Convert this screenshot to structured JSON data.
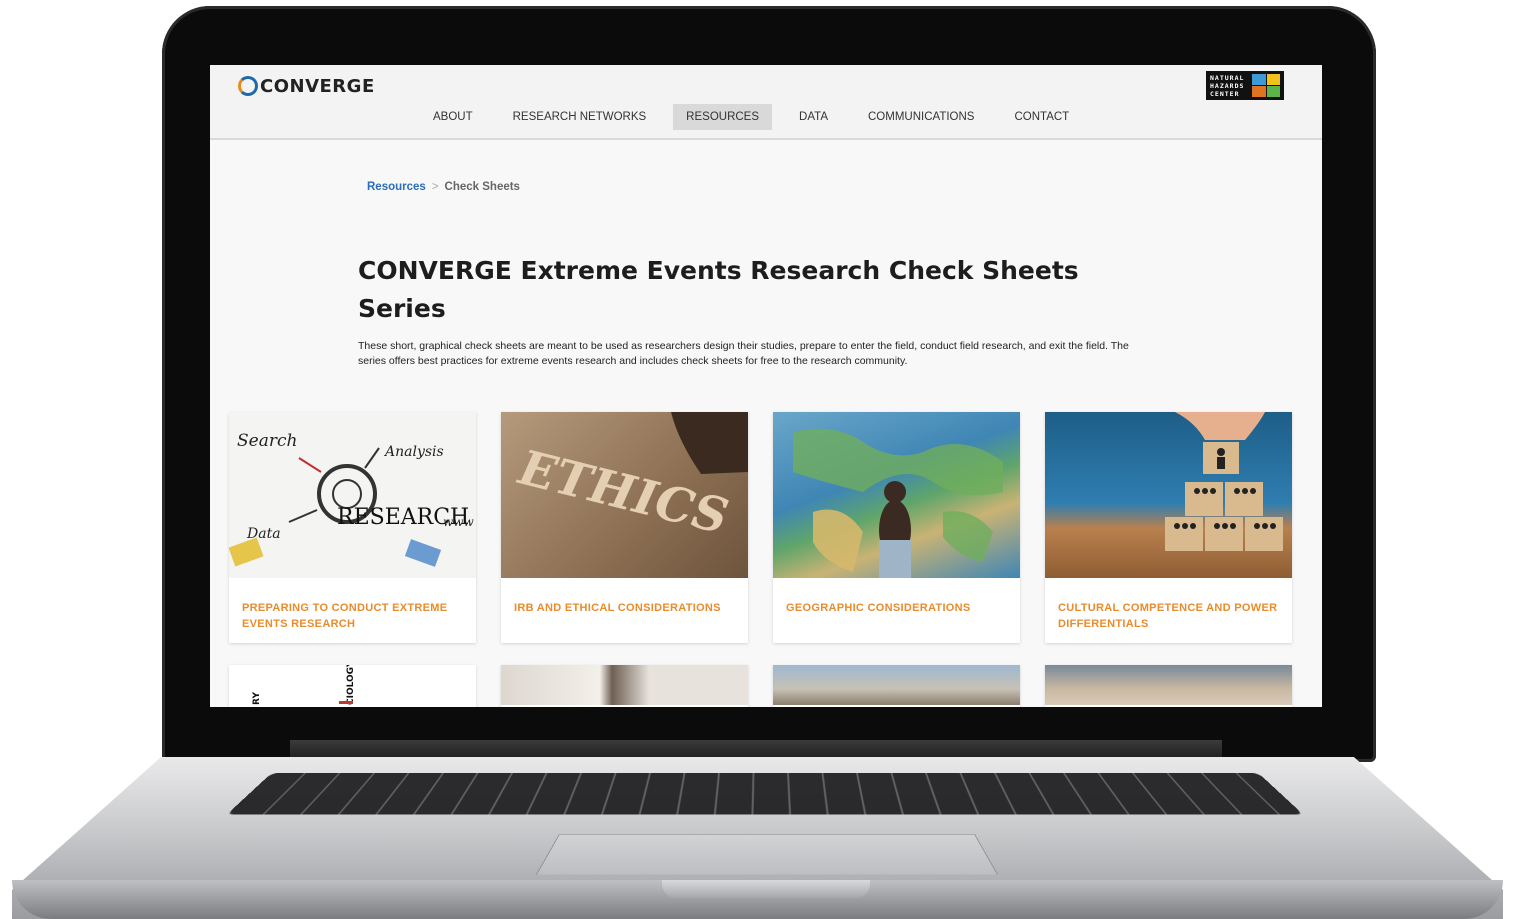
{
  "site": {
    "logo_text": "CONVERGE",
    "partner_logo_text": "NATURAL\nHAZARDS\nCENTER"
  },
  "nav": {
    "items": [
      "ABOUT",
      "RESEARCH NETWORKS",
      "RESOURCES",
      "DATA",
      "COMMUNICATIONS",
      "CONTACT"
    ],
    "active": "RESOURCES"
  },
  "breadcrumb": {
    "parent": "Resources",
    "separator": ">",
    "current": "Check Sheets"
  },
  "page": {
    "title": "CONVERGE Extreme Events Research Check Sheets Series",
    "description": "These short, graphical check sheets are meant to be used as researchers design their studies, prepare to enter the field, conduct field research, and exit the field. The series offers best practices for extreme events research and includes check sheets for free to the research community."
  },
  "cards": [
    {
      "label": "PREPARING TO CONDUCT EXTREME EVENTS RESEARCH",
      "image_words": [
        "Search",
        "Analysis",
        "RESEARCH",
        "Data",
        "www"
      ]
    },
    {
      "label": "IRB AND ETHICAL CONSIDERATIONS",
      "image_words": [
        "ETHICS"
      ]
    },
    {
      "label": "GEOGRAPHIC CONSIDERATIONS"
    },
    {
      "label": "CULTURAL COMPETENCE AND POWER DIFFERENTIALS"
    }
  ],
  "row2_image_words": [
    "RY",
    "CIOLOGY"
  ],
  "colors": {
    "accent_orange": "#e88c2c",
    "link_blue": "#2a6db8",
    "nav_active_bg": "#d9d9d9"
  }
}
